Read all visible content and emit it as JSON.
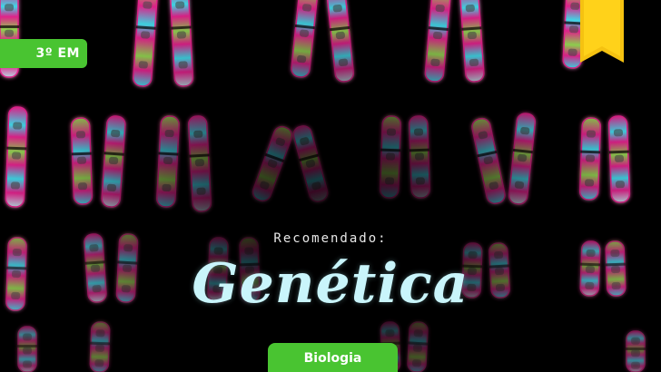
{
  "card": {
    "level_badge": "3º EM",
    "recommended_label": "Recomendado:",
    "topic_title": "Genética",
    "subject_tab": "Biologia"
  },
  "colors": {
    "badge_green": "#49c431",
    "bookmark_yellow": "#f5c211",
    "title_text": "#c9f5fb",
    "chromosome_magenta": "#e0218a",
    "chromosome_cyan": "#3fd7e6",
    "chromosome_green": "#8fd14f"
  },
  "icons": {
    "bookmark": "bookmark-icon"
  }
}
